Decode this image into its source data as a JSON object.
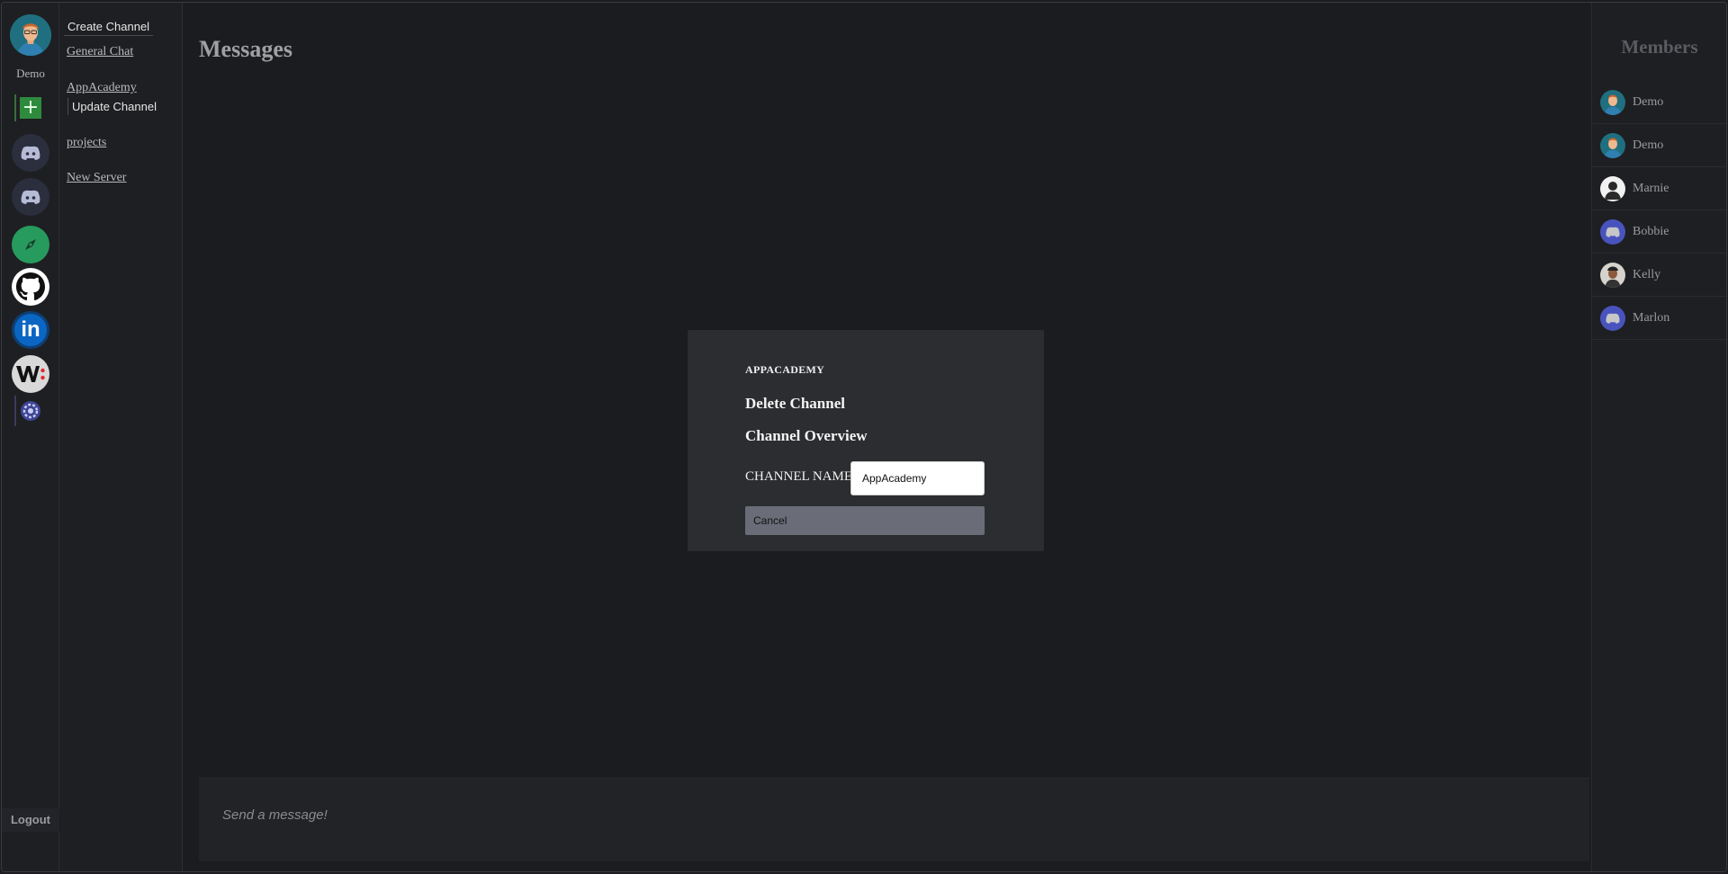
{
  "user": {
    "name": "Demo"
  },
  "channels": {
    "create_label": "Create Channel",
    "update_label": "Update Channel",
    "items": [
      {
        "label": "General Chat"
      },
      {
        "label": "AppAcademy"
      },
      {
        "label": "projects"
      },
      {
        "label": "New Server"
      }
    ]
  },
  "main": {
    "title": "Messages",
    "composer_placeholder": "Send a message!"
  },
  "members": {
    "title": "Members",
    "items": [
      {
        "name": "Demo",
        "icon": "avatar-man-icon"
      },
      {
        "name": "Demo",
        "icon": "avatar-man-icon"
      },
      {
        "name": "Marnie",
        "icon": "avatar-silhouette-icon"
      },
      {
        "name": "Bobbie",
        "icon": "discord-icon"
      },
      {
        "name": "Kelly",
        "icon": "avatar-man-icon"
      },
      {
        "name": "Marlon",
        "icon": "discord-icon"
      }
    ]
  },
  "sidebar": {
    "logout_label": "Logout",
    "servers": [
      {
        "icon": "plus-icon"
      },
      {
        "icon": "discord-icon"
      },
      {
        "icon": "discord-icon"
      },
      {
        "icon": "compass-icon"
      },
      {
        "icon": "github-icon"
      },
      {
        "icon": "linkedin-icon"
      },
      {
        "icon": "wellfound-icon"
      },
      {
        "icon": "settings-icon"
      }
    ]
  },
  "modal": {
    "server_name": "APPACADEMY",
    "delete_label": "Delete Channel",
    "overview_label": "Channel Overview",
    "channel_name_label": "CHANNEL NAME",
    "channel_name_value": "AppAcademy",
    "cancel_label": "Cancel"
  },
  "colors": {
    "background": "#1b1c1f",
    "modal": "#2c2d31",
    "cancel_button": "#6a6d78",
    "add_server": "#2e8b3d",
    "linkedin": "#0a66c2",
    "compass": "#279b5e"
  }
}
